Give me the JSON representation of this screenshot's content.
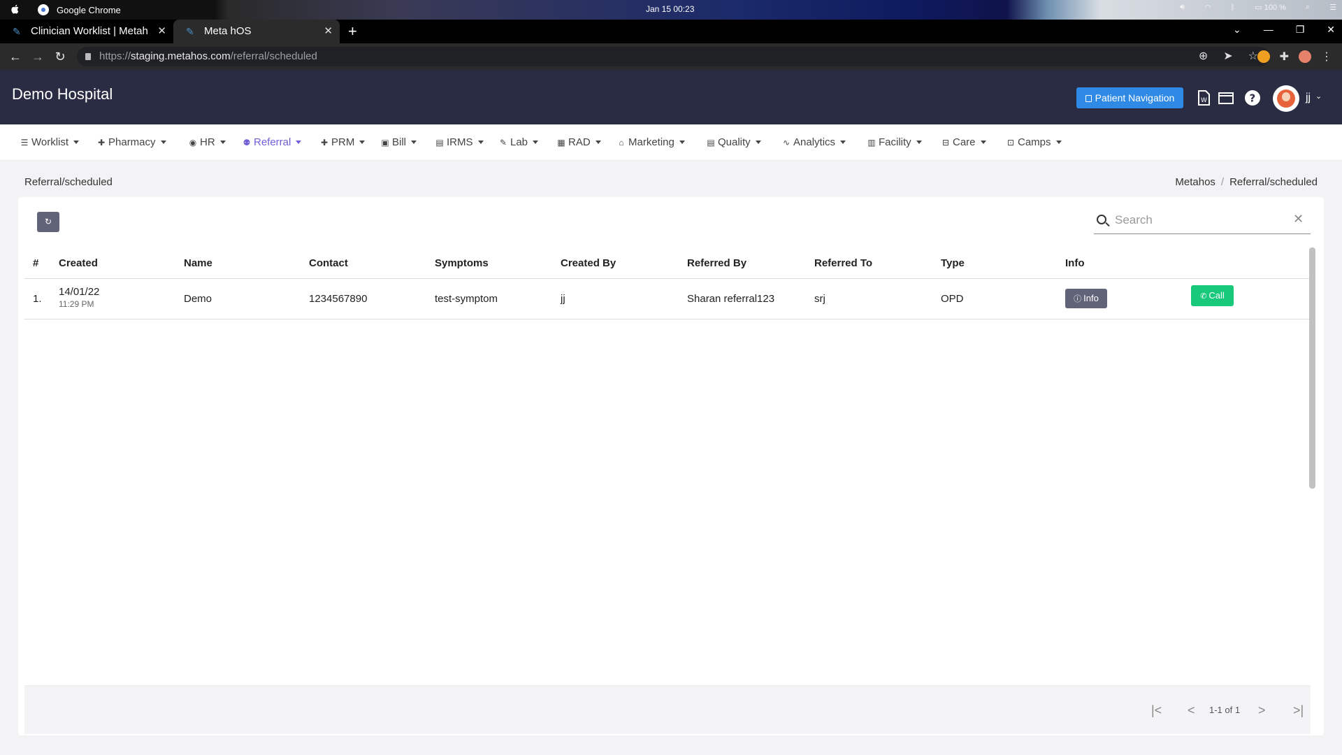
{
  "os": {
    "app_name": "Google Chrome",
    "clock": "Jan 15  00:23",
    "battery": "100 %"
  },
  "browser": {
    "tabs": [
      {
        "title": "Clinician Worklist | Metah"
      },
      {
        "title": "Meta hOS"
      }
    ],
    "url_scheme": "https://",
    "url_host": "staging.metahos.com",
    "url_path": "/referral/scheduled"
  },
  "header": {
    "hospital_name": "Demo Hospital",
    "patient_nav_label": "Patient Navigation",
    "user_name": "jj"
  },
  "menu": [
    {
      "label": "Worklist",
      "icon": "list-icon",
      "glyph": "☰"
    },
    {
      "label": "Pharmacy",
      "icon": "plus-icon",
      "glyph": "✚"
    },
    {
      "label": "HR",
      "icon": "user-circle-icon",
      "glyph": "◉"
    },
    {
      "label": "Referral",
      "icon": "users-icon",
      "glyph": "⚉"
    },
    {
      "label": "PRM",
      "icon": "plus-icon",
      "glyph": "✚"
    },
    {
      "label": "Bill",
      "icon": "money-icon",
      "glyph": "▣"
    },
    {
      "label": "IRMS",
      "icon": "id-card-icon",
      "glyph": "▤"
    },
    {
      "label": "Lab",
      "icon": "pen-icon",
      "glyph": "✎"
    },
    {
      "label": "RAD",
      "icon": "film-icon",
      "glyph": "▦"
    },
    {
      "label": "Marketing",
      "icon": "bag-icon",
      "glyph": "⌂"
    },
    {
      "label": "Quality",
      "icon": "id-card-icon",
      "glyph": "▤"
    },
    {
      "label": "Analytics",
      "icon": "pulse-icon",
      "glyph": "∿"
    },
    {
      "label": "Facility",
      "icon": "building-icon",
      "glyph": "▥"
    },
    {
      "label": "Care",
      "icon": "bed-icon",
      "glyph": "⊟"
    },
    {
      "label": "Camps",
      "icon": "briefcase-icon",
      "glyph": "⊡"
    }
  ],
  "page": {
    "title": "Referral/scheduled",
    "breadcrumb": [
      "Metahos",
      "Referral/scheduled"
    ]
  },
  "search": {
    "placeholder": "Search",
    "value": ""
  },
  "table": {
    "columns": [
      "#",
      "Created",
      "Name",
      "Contact",
      "Symptoms",
      "Created By",
      "Referred By",
      "Referred To",
      "Type",
      "Info"
    ],
    "rows": [
      {
        "index": "1.",
        "created_date": "14/01/22",
        "created_time": "11:29 PM",
        "name": "Demo",
        "contact": "1234567890",
        "symptoms": "test-symptom",
        "created_by": "jj",
        "referred_by": "Sharan referral123",
        "referred_to": "srj",
        "type": "OPD",
        "info_label": "Info",
        "call_label": "Call"
      }
    ]
  },
  "pagination": {
    "range_text": "1-1 of 1"
  },
  "colors": {
    "header_bg": "#292c42",
    "accent": "#6f5fd8",
    "primary_button": "#2f8ae5",
    "call_button": "#18c97c",
    "secondary_button": "#616478"
  }
}
